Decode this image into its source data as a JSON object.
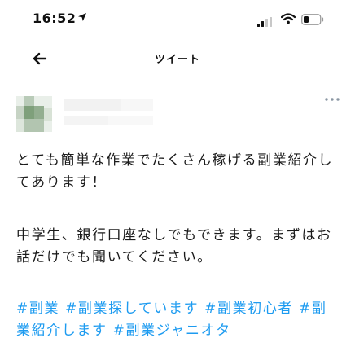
{
  "status_bar": {
    "time": "16:52"
  },
  "nav": {
    "title": "ツイート"
  },
  "tweet": {
    "paragraph1": "とても簡単な作業でたくさん稼げる副業紹介してあります！",
    "paragraph2": "中学生、銀行口座なしでもできます。まずはお話だけでも聞いてください。",
    "hashtags": "#副業 #副業探しています #副業初心者 #副業紹介します #副業ジャニオタ"
  },
  "colors": {
    "hashtag": "#1d9bf0",
    "text": "#1a1a1a"
  },
  "icons": {
    "back": "arrow-left-icon",
    "more": "more-dots-icon"
  }
}
